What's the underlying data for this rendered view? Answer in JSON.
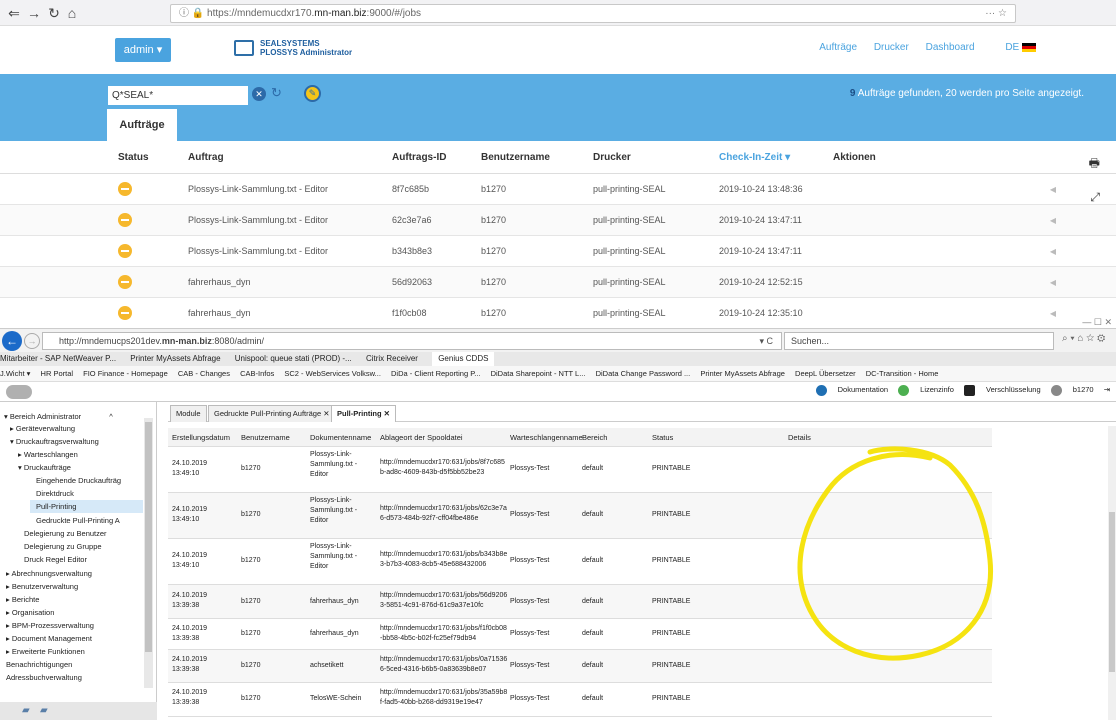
{
  "browser1": {
    "url_prefix": "https://mndemucdxr170.",
    "url_domain": "mn-man.biz",
    "url_suffix": ":9000/#/jobs",
    "right_icons": "··· ☆"
  },
  "app": {
    "admin_label": "admin ▾",
    "brand_line1": "SEALSYSTEMS",
    "brand_line2": "PLOSSYS Administrator",
    "nav": [
      "Aufträge",
      "Drucker",
      "Dashboard",
      "DE"
    ]
  },
  "search": {
    "value": "*SEAL*",
    "found_count": "9",
    "found_text": " Aufträge gefunden, 20 werden pro Seite angezeigt."
  },
  "tab_label": "Aufträge",
  "jobs": {
    "headers": [
      "Status",
      "Auftrag",
      "Auftrags-ID",
      "Benutzername",
      "Drucker",
      "Check-In-Zeit ▾",
      "Aktionen"
    ],
    "rows": [
      {
        "name": "Plossys-Link-Sammlung.txt - Editor",
        "id": "8f7c685b",
        "user": "b1270",
        "printer": "pull-printing-SEAL",
        "time": "2019-10-24 13:48:36"
      },
      {
        "name": "Plossys-Link-Sammlung.txt - Editor",
        "id": "62c3e7a6",
        "user": "b1270",
        "printer": "pull-printing-SEAL",
        "time": "2019-10-24 13:47:11"
      },
      {
        "name": "Plossys-Link-Sammlung.txt - Editor",
        "id": "b343b8e3",
        "user": "b1270",
        "printer": "pull-printing-SEAL",
        "time": "2019-10-24 13:47:11"
      },
      {
        "name": "fahrerhaus_dyn",
        "id": "56d92063",
        "user": "b1270",
        "printer": "pull-printing-SEAL",
        "time": "2019-10-24 12:52:15"
      },
      {
        "name": "fahrerhaus_dyn",
        "id": "f1f0cb08",
        "user": "b1270",
        "printer": "pull-printing-SEAL",
        "time": "2019-10-24 12:35:10"
      }
    ]
  },
  "browser2": {
    "url_prefix": "http://mndemucps201dev.",
    "url_domain": "mn-man.biz",
    "url_suffix": ":8080/admin/",
    "url_right": "▾ C",
    "search_placeholder": "Suchen...",
    "tabs": [
      "Mitarbeiter - SAP NetWeaver P...",
      "Printer MyAssets Abfrage",
      "Unispool: queue stati (PROD) -...",
      "Citrix Receiver",
      "Genius CDDS"
    ],
    "favorites": [
      "J.Wicht ▾",
      "HR Portal",
      "FIO Finance - Homepage",
      "CAB - Changes",
      "CAB-Infos",
      "SC2 - WebServices Volksw...",
      "DiDa - Client Reporting P...",
      "DiData Sharepoint - NTT L...",
      "DiData Change Password ...",
      "Printer MyAssets Abfrage",
      "DeepL Übersetzer",
      "DC-Transition - Home"
    ],
    "app_top_right": [
      "Dokumentation",
      "Lizenzinfo",
      "Verschlüsselung",
      "b1270"
    ]
  },
  "sidebar": {
    "items": [
      "Bereich Administrator",
      "Geräteverwaltung",
      "Druckauftragsverwaltung",
      "Warteschlangen",
      "Druckaufträge",
      "Eingehende Druckaufträg",
      "Direktdruck",
      "Pull-Printing",
      "Gedruckte Pull-Printing A",
      "Delegierung zu Benutzer",
      "Delegierung zu Gruppe",
      "Druck Regel Editor",
      "Abrechnungsverwaltung",
      "Benutzerverwaltung",
      "Berichte",
      "Organisation",
      "BPM-Prozessverwaltung",
      "Document Management",
      "Erweiterte Funktionen",
      "Benachrichtigungen",
      "Adressbuchverwaltung"
    ]
  },
  "module_tabs": [
    "Module",
    "Gedruckte Pull-Printing Aufträge ✕",
    "Pull-Printing ✕"
  ],
  "spool": {
    "headers": [
      "Erstellungsdatum",
      "Benutzername",
      "Dokumentenname",
      "Ablageort der Spooldatei",
      "Warteschlangenname",
      "Bereich",
      "Status",
      "Details"
    ],
    "rows": [
      {
        "date": "24.10.2019 13:49:10",
        "user": "b1270",
        "doc": "Plossys-Link-Sammlung.txt - Editor",
        "path": "http://mndemucdxr170:631/jobs/8f7c685b-ad8c-4609-843b-d5f5bb52be23",
        "queue": "Plossys-Test",
        "area": "default",
        "status": "PRINTABLE"
      },
      {
        "date": "24.10.2019 13:49:10",
        "user": "b1270",
        "doc": "Plossys-Link-Sammlung.txt - Editor",
        "path": "http://mndemucdxr170:631/jobs/62c3e7a6-d573-484b-92f7-cff04fbe486e",
        "queue": "Plossys-Test",
        "area": "default",
        "status": "PRINTABLE"
      },
      {
        "date": "24.10.2019 13:49:10",
        "user": "b1270",
        "doc": "Plossys-Link-Sammlung.txt - Editor",
        "path": "http://mndemucdxr170:631/jobs/b343b8e3-b7b3-4083-8cb5-45e688432006",
        "queue": "Plossys-Test",
        "area": "default",
        "status": "PRINTABLE"
      },
      {
        "date": "24.10.2019 13:39:38",
        "user": "b1270",
        "doc": "fahrerhaus_dyn",
        "path": "http://mndemucdxr170:631/jobs/56d92063-5851-4c91-876d-61c9a37e10fc",
        "queue": "Plossys-Test",
        "area": "default",
        "status": "PRINTABLE"
      },
      {
        "date": "24.10.2019 13:39:38",
        "user": "b1270",
        "doc": "fahrerhaus_dyn",
        "path": "http://mndemucdxr170:631/jobs/f1f0cb08-bb58-4b5c-b02f-fc25ef79db94",
        "queue": "Plossys-Test",
        "area": "default",
        "status": "PRINTABLE"
      },
      {
        "date": "24.10.2019 13:39:38",
        "user": "b1270",
        "doc": "achsetikett",
        "path": "http://mndemucdxr170:631/jobs/0a715366-5ced-4316-b6b5-0a83639b8e07",
        "queue": "Plossys-Test",
        "area": "default",
        "status": "PRINTABLE"
      },
      {
        "date": "24.10.2019 13:39:38",
        "user": "b1270",
        "doc": "TelosWE-Schein",
        "path": "http://mndemucdxr170:631/jobs/35a59b8f-fad5-40bb-b268-dd9319e19e47",
        "queue": "Plossys-Test",
        "area": "default",
        "status": "PRINTABLE"
      }
    ]
  },
  "colors": {
    "accent": "#5aade3",
    "status_pending": "#f6b82d",
    "annotation": "#f5e311"
  }
}
